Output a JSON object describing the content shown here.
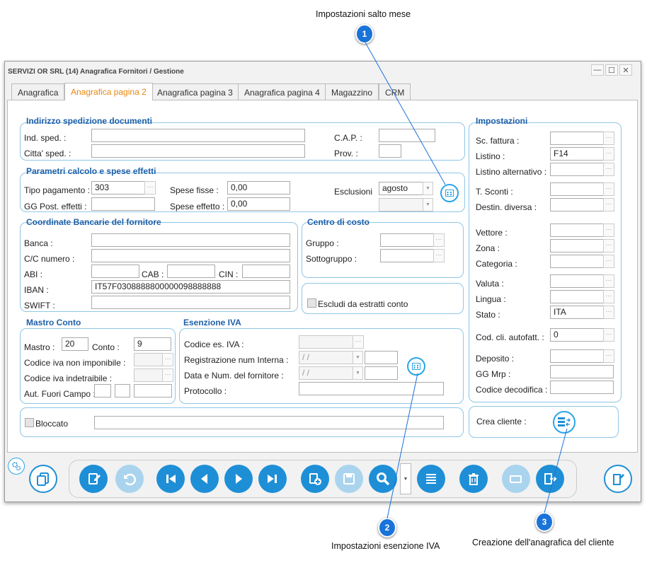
{
  "annotations": [
    {
      "number": "1",
      "text": "Impostazioni salto mese"
    },
    {
      "number": "2",
      "text": "Impostazioni esenzione IVA"
    },
    {
      "number": "3",
      "text": "Creazione dell'anagrafica del cliente"
    }
  ],
  "window": {
    "title": "SERVIZI OR SRL (14) Anagrafica Fornitori / Gestione",
    "controls": [
      "—",
      "☐",
      "✕"
    ]
  },
  "tabs": [
    {
      "label": "Anagrafica",
      "active": false
    },
    {
      "label": "Anagrafica pagina 2",
      "active": true
    },
    {
      "label": "Anagrafica pagina 3",
      "active": false
    },
    {
      "label": "Anagrafica pagina 4",
      "active": false
    },
    {
      "label": "Magazzino",
      "active": false
    },
    {
      "label": "CRM",
      "active": false
    }
  ],
  "spedizione": {
    "title": "Indirizzo spedizione documenti",
    "ind_sped": {
      "label": "Ind. sped. :",
      "value": ""
    },
    "citta_sped": {
      "label": "Citta' sped. :",
      "value": ""
    },
    "cap": {
      "label": "C.A.P. :",
      "value": ""
    },
    "prov": {
      "label": "Prov. :",
      "value": ""
    }
  },
  "parametri": {
    "title": "Parametri calcolo e spese effetti",
    "tipo_pagamento": {
      "label": "Tipo pagamento :",
      "value": "303"
    },
    "gg_post": {
      "label": "GG Post. effetti :",
      "value": ""
    },
    "spese_fisse": {
      "label": "Spese fisse :",
      "value": "0,00"
    },
    "spese_effetto": {
      "label": "Spese effetto :",
      "value": "0,00"
    },
    "esclusioni": {
      "label": "Esclusioni",
      "value1": "agosto",
      "value2": ""
    }
  },
  "bancarie": {
    "title": "Coordinate Bancarie del fornitore",
    "banca": {
      "label": "Banca :",
      "value": ""
    },
    "cc": {
      "label": "C/C numero :",
      "value": ""
    },
    "abi": {
      "label": "ABI :",
      "value": ""
    },
    "cab": {
      "label": "CAB :",
      "value": ""
    },
    "cin": {
      "label": "CIN :",
      "value": ""
    },
    "iban": {
      "label": "IBAN :",
      "value": "IT57F0308888800000098888888"
    },
    "swift": {
      "label": "SWIFT :",
      "value": ""
    }
  },
  "centro_costo": {
    "title": "Centro di costo",
    "gruppo": {
      "label": "Gruppo :",
      "value": ""
    },
    "sottogruppo": {
      "label": "Sottogruppo :",
      "value": ""
    }
  },
  "escludi": {
    "label": "Escludi da estratti conto",
    "checked": false
  },
  "mastro_conto": {
    "title": "Mastro Conto",
    "mastro": {
      "label": "Mastro :",
      "value": "20"
    },
    "conto": {
      "label": "Conto :",
      "value": "9"
    },
    "iva_non_imponibile": {
      "label": "Codice iva non imponibile :",
      "value": ""
    },
    "iva_indetraibile": {
      "label": "Codice iva indetraibile :",
      "value": ""
    },
    "aut_fuori_campo": {
      "label": "Aut. Fuori Campo :",
      "value": ""
    }
  },
  "esenzione": {
    "title": "Esenzione IVA",
    "codice_es": {
      "label": "Codice es. IVA :",
      "value": ""
    },
    "reg_num": {
      "label": "Registrazione num Interna :",
      "date": " /  /"
    },
    "data_num": {
      "label": "Data e Num. del fornitore :",
      "date": " /  /"
    },
    "protocollo": {
      "label": "Protocollo :",
      "value": ""
    }
  },
  "bloccato": {
    "label": "Bloccato",
    "checked": false,
    "value": ""
  },
  "impostazioni": {
    "title": "Impostazioni",
    "fields": [
      {
        "key": "sc_fattura",
        "label": "Sc. fattura :",
        "value": ""
      },
      {
        "key": "listino",
        "label": "Listino :",
        "value": "F14"
      },
      {
        "key": "listino_alt",
        "label": "Listino alternativo :",
        "value": ""
      },
      {
        "key": "t_sconti",
        "label": "T. Sconti :",
        "value": ""
      },
      {
        "key": "destin",
        "label": "Destin. diversa :",
        "value": ""
      },
      {
        "key": "vettore",
        "label": "Vettore :",
        "value": ""
      },
      {
        "key": "zona",
        "label": "Zona :",
        "value": ""
      },
      {
        "key": "categoria",
        "label": "Categoria :",
        "value": ""
      },
      {
        "key": "valuta",
        "label": "Valuta :",
        "value": ""
      },
      {
        "key": "lingua",
        "label": "Lingua :",
        "value": ""
      },
      {
        "key": "stato",
        "label": "Stato :",
        "value": "ITA"
      },
      {
        "key": "cod_cli",
        "label": "Cod. cli. autofatt. :",
        "value": "0"
      },
      {
        "key": "deposito",
        "label": "Deposito :",
        "value": ""
      },
      {
        "key": "gg_mrp",
        "label": "GG Mrp :",
        "value": ""
      },
      {
        "key": "codice_decod",
        "label": "Codice decodifica :",
        "value": ""
      }
    ]
  },
  "crea_cliente": {
    "label": "Crea cliente :"
  },
  "toolbar": {
    "buttons": [
      "copy-record-icon",
      "edit-icon",
      "undo-icon",
      "first-record-icon",
      "previous-record-icon",
      "next-record-icon",
      "last-record-icon",
      "new-record-icon",
      "save-icon",
      "search-icon",
      "list-icon",
      "delete-icon",
      "print-icon",
      "exit-icon",
      "notes-icon"
    ]
  },
  "colors": {
    "accent": "#1e8fd6",
    "tab_active": "#e8870d",
    "group_title": "#1e5fa8",
    "group_border": "#8fc6e6",
    "badge": "#1a73d9"
  }
}
